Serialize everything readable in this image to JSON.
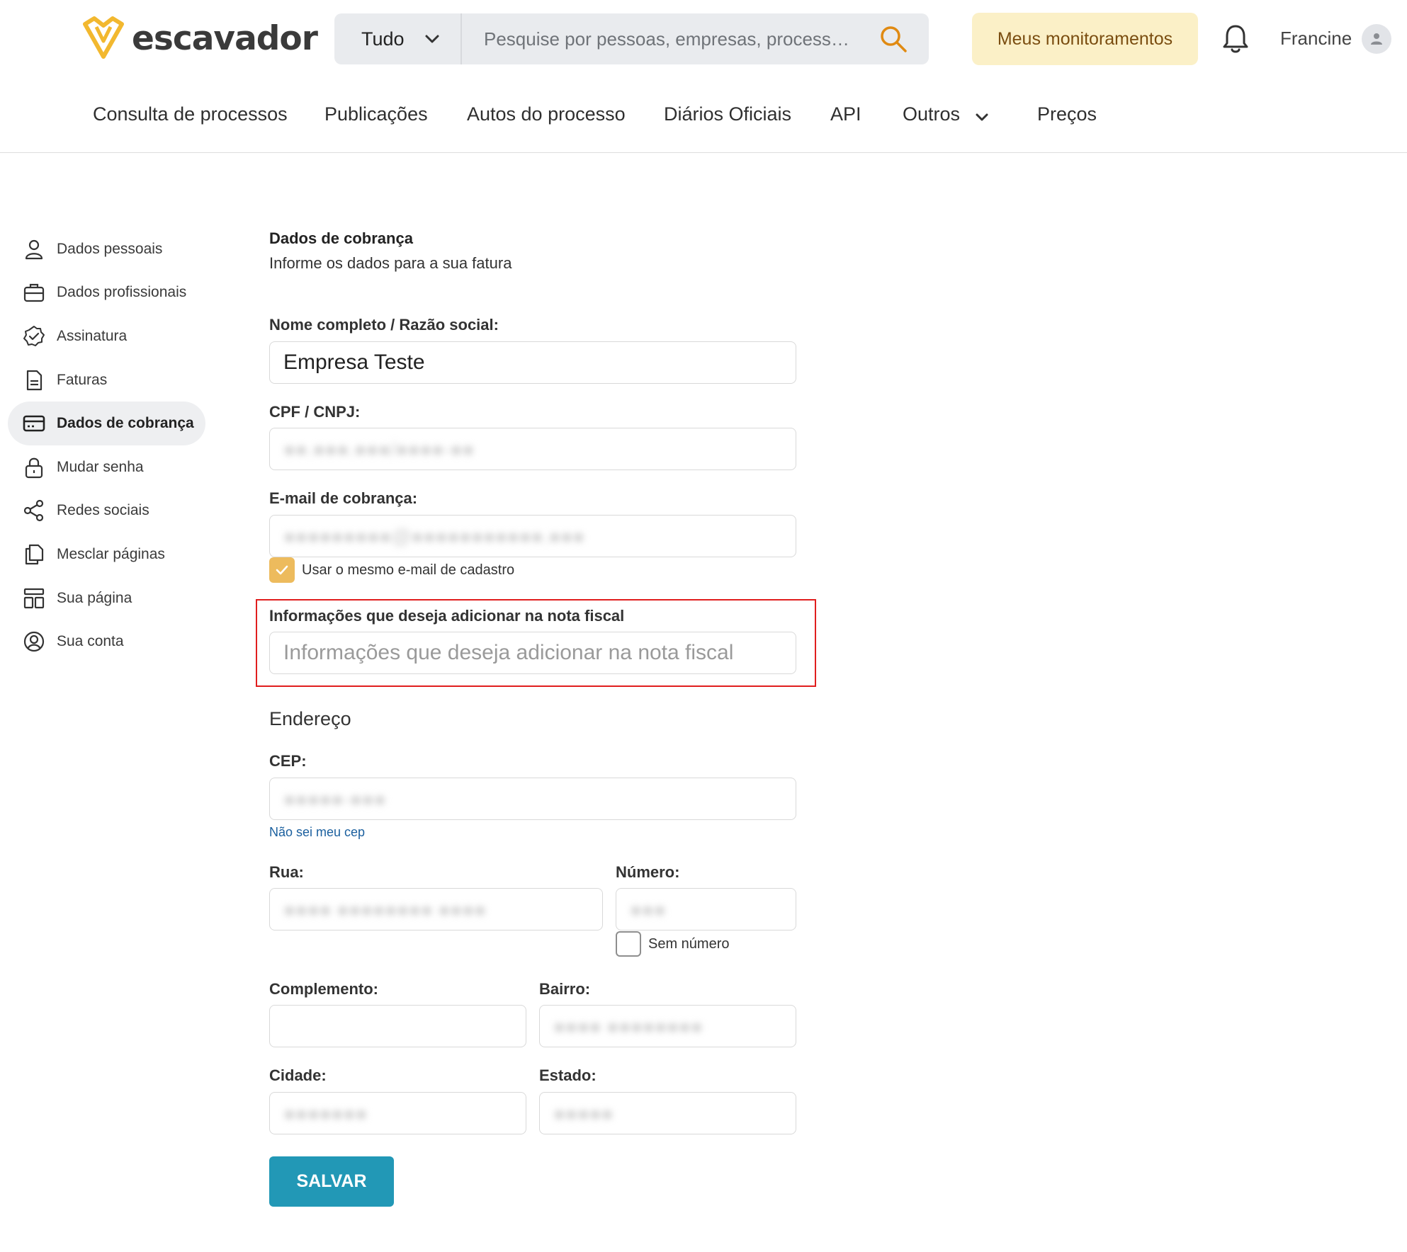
{
  "header": {
    "brand": "escavador",
    "search": {
      "scope": "Tudo",
      "placeholder": "Pesquise por pessoas, empresas, process…"
    },
    "monitor_button": "Meus monitoramentos",
    "user_name": "Francine"
  },
  "nav": {
    "items": [
      "Consulta de processos",
      "Publicações",
      "Autos do processo",
      "Diários Oficiais",
      "API",
      "Outros",
      "Preços"
    ]
  },
  "sidebar": {
    "items": [
      {
        "label": "Dados pessoais",
        "icon": "person-icon"
      },
      {
        "label": "Dados profissionais",
        "icon": "briefcase-icon"
      },
      {
        "label": "Assinatura",
        "icon": "badge-check-icon"
      },
      {
        "label": "Faturas",
        "icon": "document-icon"
      },
      {
        "label": "Dados de cobrança",
        "icon": "credit-card-icon",
        "active": true
      },
      {
        "label": "Mudar senha",
        "icon": "lock-icon"
      },
      {
        "label": "Redes sociais",
        "icon": "share-icon"
      },
      {
        "label": "Mesclar páginas",
        "icon": "copy-icon"
      },
      {
        "label": "Sua página",
        "icon": "layout-icon"
      },
      {
        "label": "Sua conta",
        "icon": "user-circle-icon"
      }
    ]
  },
  "form": {
    "title": "Dados de cobrança",
    "subtitle": "Informe os dados para a sua fatura",
    "name_label": "Nome completo / Razão social:",
    "name_value": "Empresa Teste",
    "cpf_label": "CPF / CNPJ:",
    "email_label": "E-mail de cobrança:",
    "same_email_label": "Usar o mesmo e-mail de cadastro",
    "same_email_checked": true,
    "info_label": "Informações que deseja adicionar na nota fiscal",
    "info_placeholder": "Informações que deseja adicionar na nota fiscal",
    "address_title": "Endereço",
    "cep_label": "CEP:",
    "cep_link": "Não sei meu cep",
    "street_label": "Rua:",
    "number_label": "Número:",
    "no_number_label": "Sem número",
    "no_number_checked": false,
    "complement_label": "Complemento:",
    "district_label": "Bairro:",
    "city_label": "Cidade:",
    "state_label": "Estado:",
    "save_button": "SALVAR"
  },
  "colors": {
    "accent_yellow": "#edbb5d",
    "monitor_bg": "#fbf0c7",
    "save_button": "#2298b6",
    "highlight_border": "#e01e1e",
    "link": "#1a5f9e"
  }
}
